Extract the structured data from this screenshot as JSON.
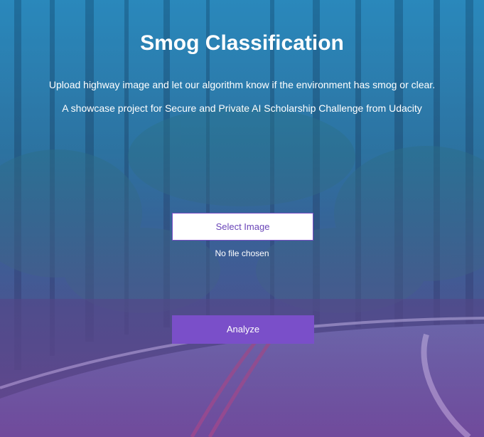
{
  "header": {
    "title": "Smog Classification",
    "description": "Upload highway image and let our algorithm know if the environment has smog or clear.",
    "showcase": "A showcase project for Secure and Private AI Scholarship Challenge from Udacity"
  },
  "upload": {
    "select_label": "Select Image",
    "file_status": "No file chosen"
  },
  "actions": {
    "analyze_label": "Analyze"
  },
  "colors": {
    "accent": "#7a4fc9",
    "overlay_top": "#1c82be",
    "overlay_bottom": "#8246aa"
  }
}
